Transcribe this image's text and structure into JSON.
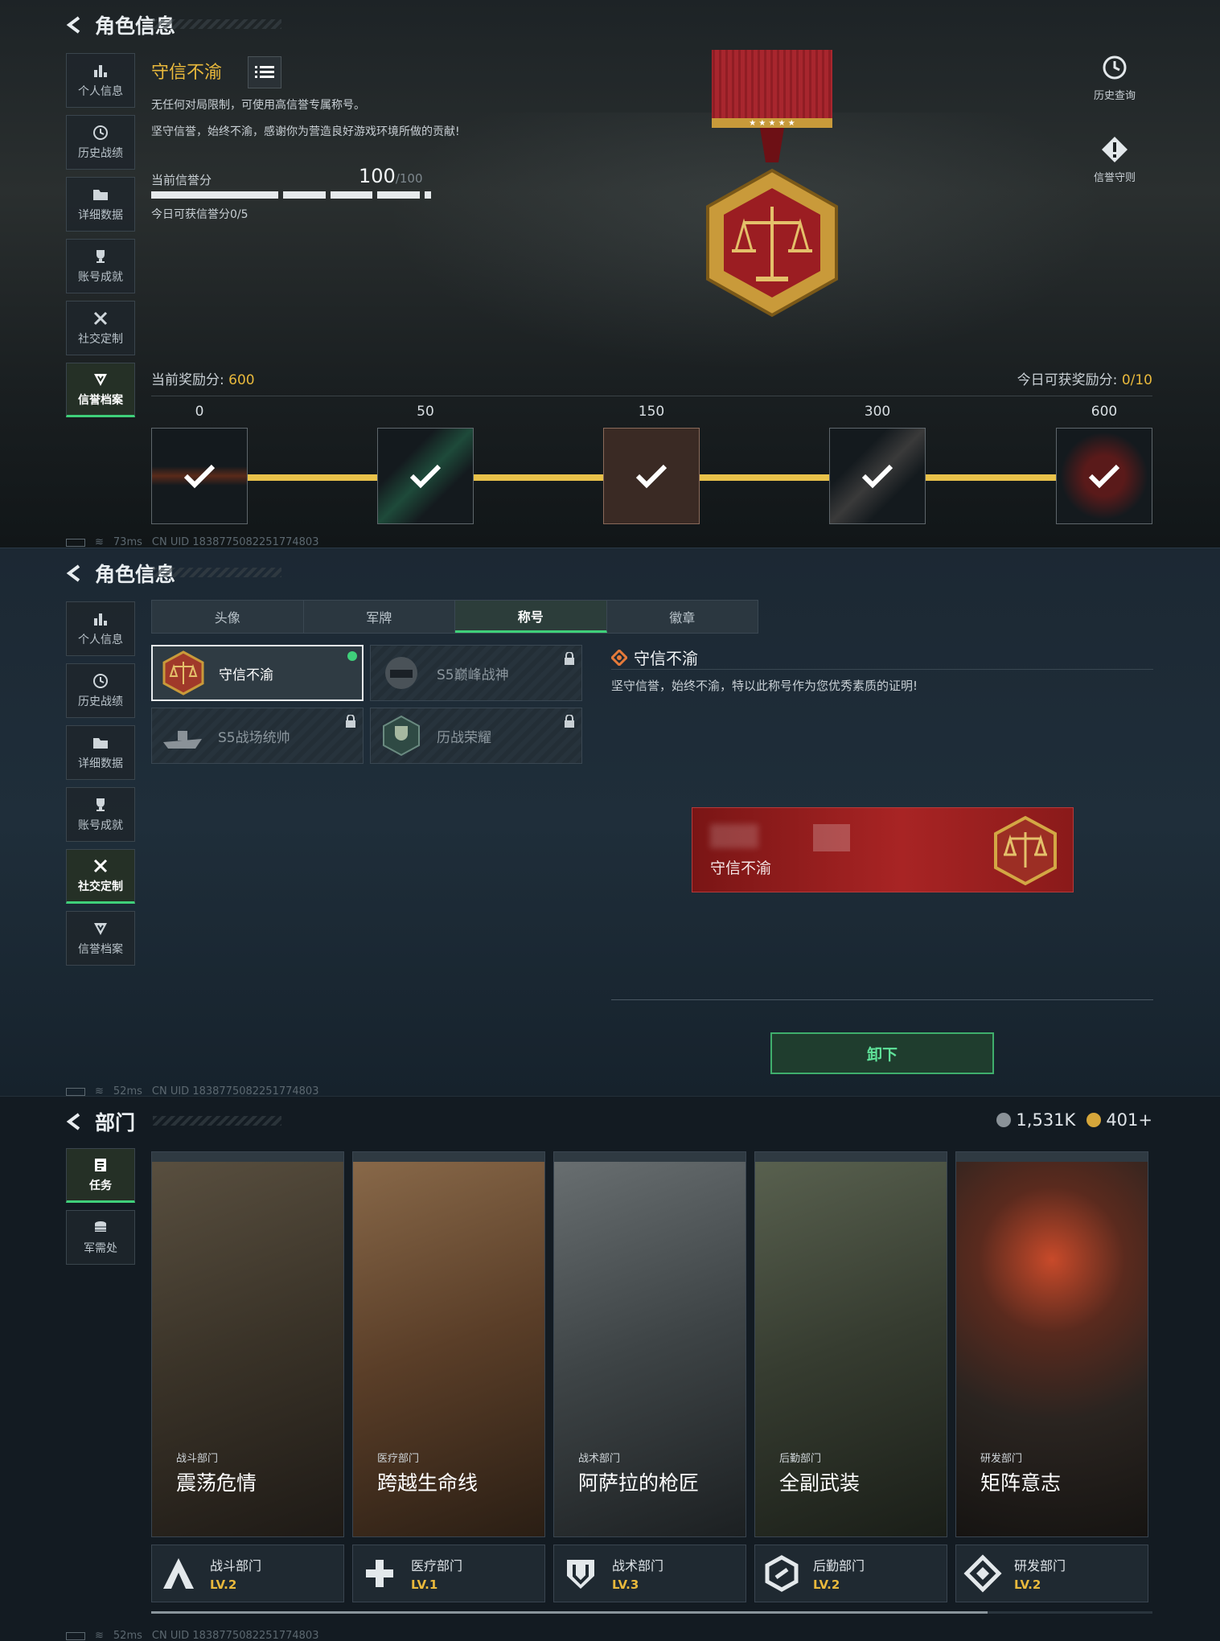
{
  "panel1": {
    "title": "角色信息",
    "sidebar": [
      {
        "label": "个人信息",
        "icon": "bar-chart-icon"
      },
      {
        "label": "历史战绩",
        "icon": "clock-icon"
      },
      {
        "label": "详细数据",
        "icon": "folder-icon"
      },
      {
        "label": "账号成就",
        "icon": "trophy-icon"
      },
      {
        "label": "社交定制",
        "icon": "tools-icon"
      },
      {
        "label": "信誉档案",
        "icon": "shield-badge-icon",
        "active": true
      }
    ],
    "credit_title": "守信不渝",
    "desc1": "无任何对局限制，可使用高信誉专属称号。",
    "desc2": "坚守信誉，始终不渝，感谢你为营造良好游戏环境所做的贡献!",
    "score_label": "当前信誉分",
    "score": "100",
    "score_max": "/100",
    "today_label": "今日可获信誉分0/5",
    "history_label": "历史查询",
    "rules_label": "信誉守则",
    "reward_label": "当前奖励分:",
    "reward_value": "600",
    "today_reward_label": "今日可获奖励分:",
    "today_reward_value": "0/10",
    "milestones": [
      "0",
      "50",
      "150",
      "300",
      "600"
    ],
    "status": {
      "ping": "73ms",
      "uid": "CN UID 1838775082251774803"
    }
  },
  "panel2": {
    "title": "角色信息",
    "sidebar": [
      {
        "label": "个人信息"
      },
      {
        "label": "历史战绩"
      },
      {
        "label": "详细数据"
      },
      {
        "label": "账号成就"
      },
      {
        "label": "社交定制",
        "active": true
      },
      {
        "label": "信誉档案"
      }
    ],
    "tabs": [
      "头像",
      "军牌",
      "称号",
      "徽章"
    ],
    "active_tab": "称号",
    "titles": [
      {
        "name": "守信不渝",
        "selected": true,
        "locked": false
      },
      {
        "name": "S5巅峰战神",
        "locked": true
      },
      {
        "name": "S5战场统帅",
        "locked": true
      },
      {
        "name": "历战荣耀",
        "locked": true
      }
    ],
    "detail_title": "守信不渝",
    "detail_desc": "坚守信誉，始终不渝，特以此称号作为您优秀素质的证明!",
    "banner_name": "守信不渝",
    "unload_label": "卸下",
    "status": {
      "ping": "52ms",
      "uid": "CN UID 1838775082251774803"
    }
  },
  "panel3": {
    "title": "部门",
    "sidebar": [
      {
        "label": "任务",
        "active": true
      },
      {
        "label": "军需处"
      }
    ],
    "currency1": "1,531K",
    "currency2": "401+",
    "departments": [
      {
        "cat": "战斗部门",
        "name": "震荡危情",
        "foot": "战斗部门",
        "lv": "LV.2",
        "color": "#4a4336"
      },
      {
        "cat": "医疗部门",
        "name": "跨越生命线",
        "foot": "医疗部门",
        "lv": "LV.1",
        "color": "#6a4a30"
      },
      {
        "cat": "战术部门",
        "name": "阿萨拉的枪匠",
        "foot": "战术部门",
        "lv": "LV.3",
        "color": "#4a5052"
      },
      {
        "cat": "后勤部门",
        "name": "全副武装",
        "foot": "后勤部门",
        "lv": "LV.2",
        "color": "#3e4538"
      },
      {
        "cat": "研发部门",
        "name": "矩阵意志",
        "foot": "研发部门",
        "lv": "LV.2",
        "color": "#3a3430"
      }
    ],
    "status": {
      "ping": "52ms",
      "uid": "CN UID 1838775082251774803"
    }
  }
}
